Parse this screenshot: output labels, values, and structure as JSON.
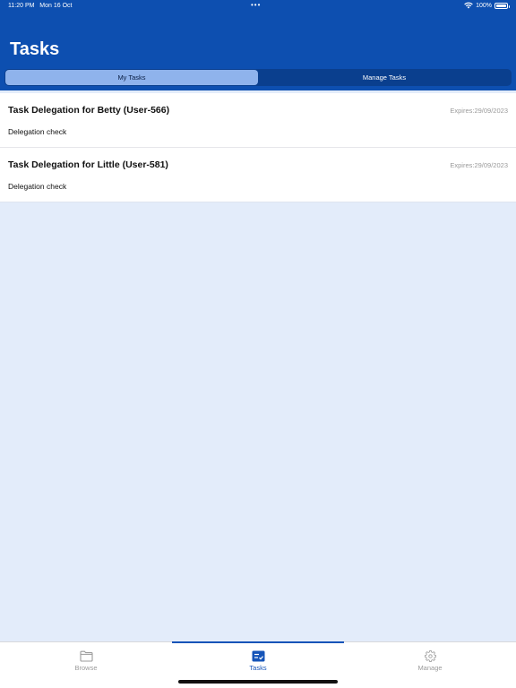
{
  "status_bar": {
    "time": "11:20 PM",
    "date": "Mon 16 Oct",
    "dots": "•••",
    "battery_percent": "100%"
  },
  "header": {
    "title": "Tasks",
    "segments": [
      "My Tasks",
      "Manage Tasks"
    ],
    "selected_segment": "My Tasks"
  },
  "tasks": [
    {
      "title": "Task Delegation for Betty (User-566)",
      "expires": "Expires:29/09/2023",
      "description": "Delegation check"
    },
    {
      "title": "Task Delegation for Little (User-581)",
      "expires": "Expires:29/09/2023",
      "description": "Delegation check"
    }
  ],
  "tab_bar": {
    "items": [
      {
        "label": "Browse",
        "icon": "folder-icon"
      },
      {
        "label": "Tasks",
        "icon": "tasks-icon"
      },
      {
        "label": "Manage",
        "icon": "gear-icon"
      }
    ],
    "selected": "Tasks"
  },
  "colors": {
    "header_bg": "#0d4fb0",
    "accent": "#1554b8",
    "page_bg": "#e3ecfa"
  }
}
